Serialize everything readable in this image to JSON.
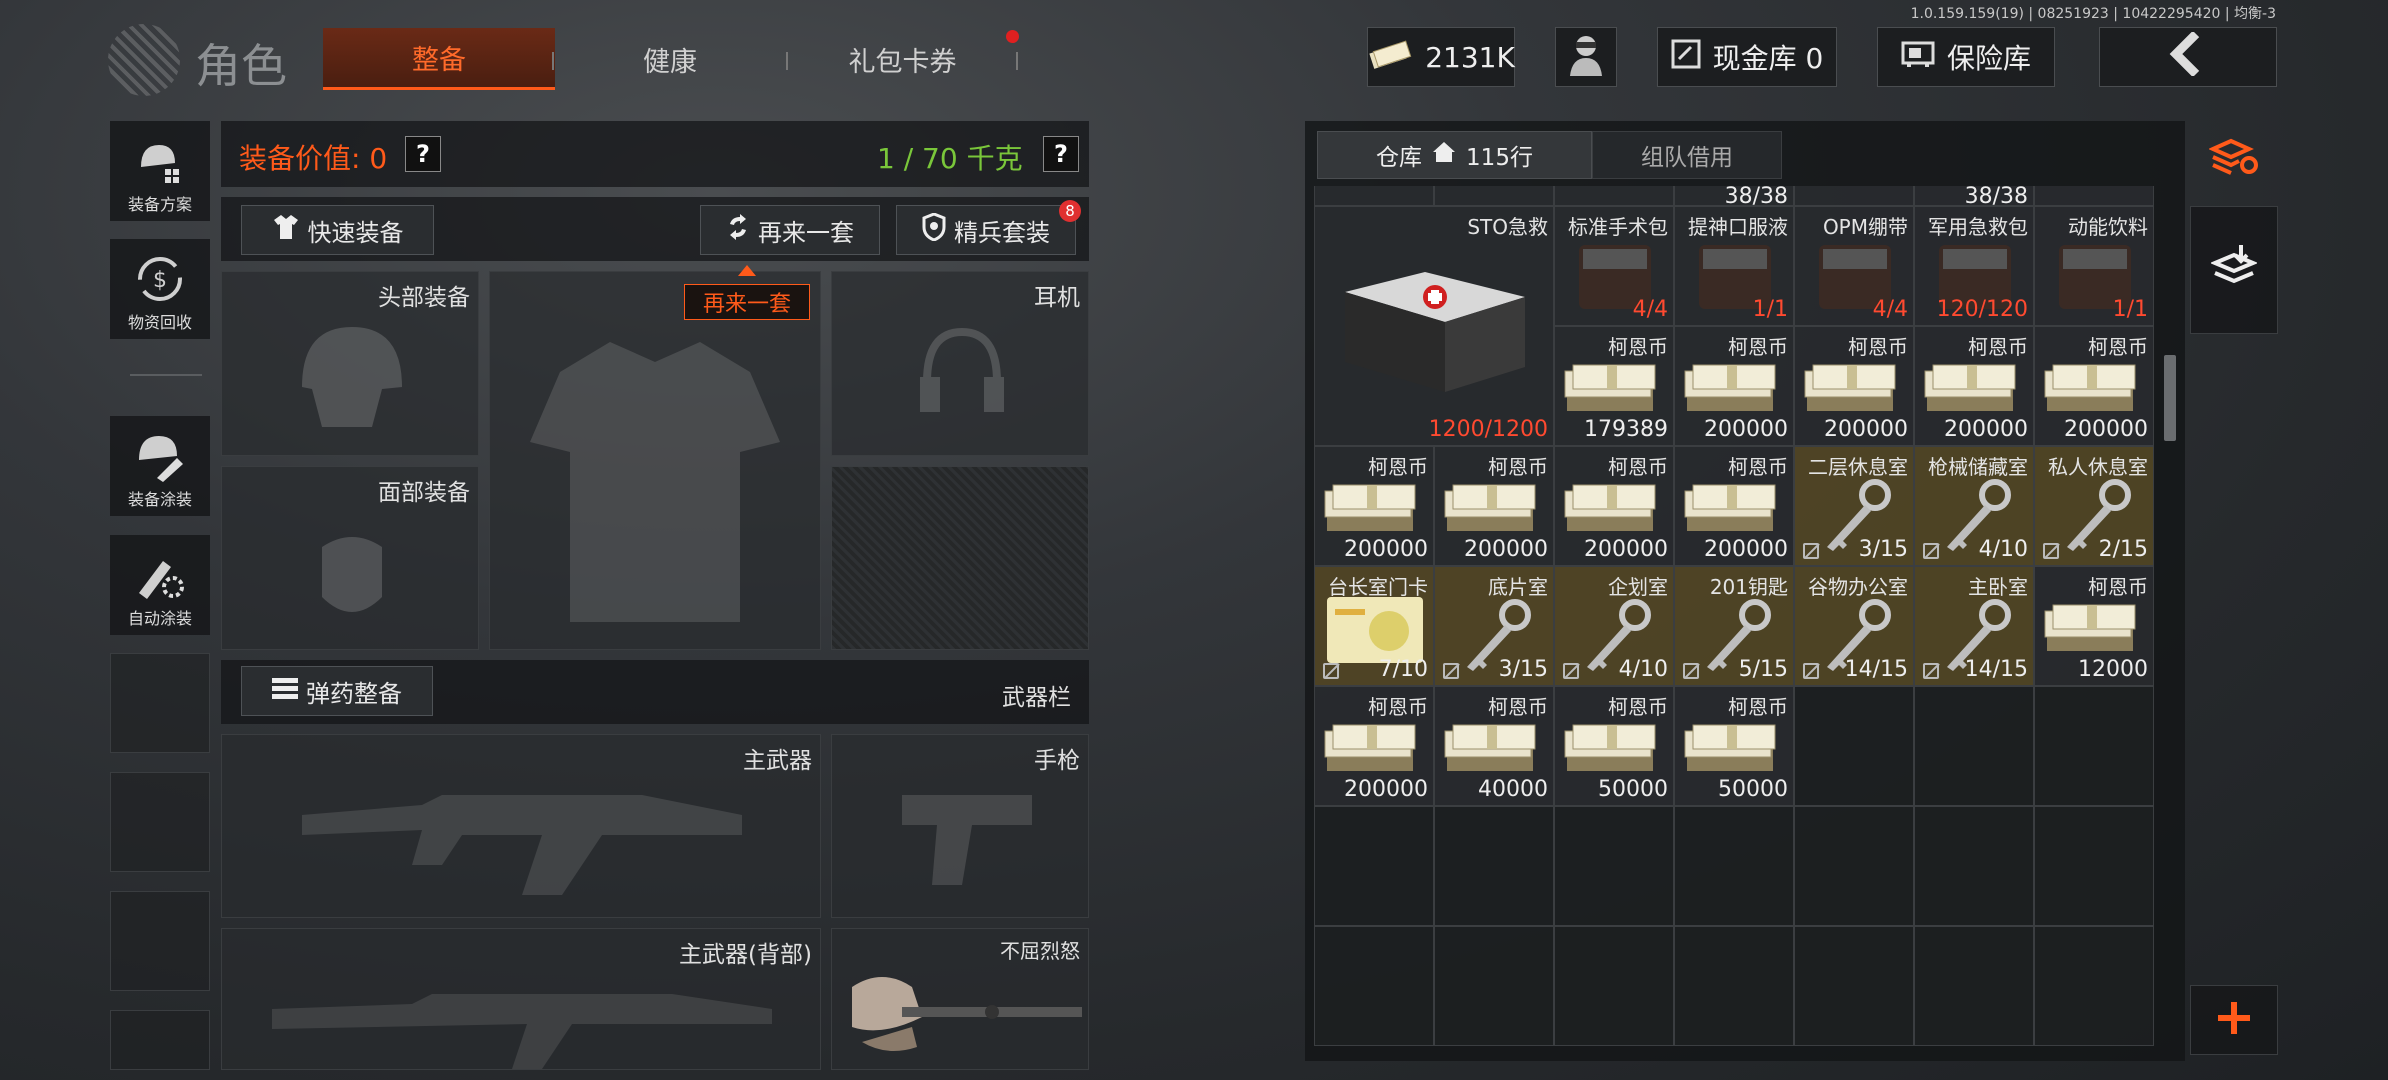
{
  "version": "1.0.159.159(19) | 08251923 | 10422295420 | 均衡-3",
  "header": {
    "title": "角色",
    "tabs": [
      "整备",
      "健康",
      "礼包卡券"
    ],
    "money": "2131K",
    "cash_vault": "现金库 0",
    "safe": "保险库"
  },
  "loadout": {
    "value_label": "装备价值: 0",
    "weight": "1 / 70 千克",
    "quick_equip": "快速装备",
    "again": "再来一套",
    "elite": "精兵套装",
    "elite_badge": "8",
    "tooltip": "再来一套"
  },
  "sidebar": [
    "装备方案",
    "物资回收",
    "装备涂装",
    "自动涂装"
  ],
  "slots": {
    "head": "头部装备",
    "face": "面部装备",
    "earphone": "耳机",
    "ammo": "弹药整备",
    "weapon_bar": "武器栏",
    "primary": "主武器",
    "pistol": "手枪",
    "primary_back": "主武器(背部)",
    "melee": "不屈烈怒"
  },
  "warehouse": {
    "tab_label": "仓库",
    "rows": "115行",
    "team_borrow": "组队借用",
    "partial_top": [
      "38/38",
      "38/38"
    ],
    "sto": {
      "name": "STO急救",
      "count": "1200/1200"
    },
    "items": [
      {
        "name": "标准手术包",
        "count": "4/4",
        "red": true
      },
      {
        "name": "提神口服液",
        "count": "1/1",
        "red": true
      },
      {
        "name": "OPM绷带",
        "count": "4/4",
        "red": true
      },
      {
        "name": "军用急救包",
        "count": "120/120",
        "red": true
      },
      {
        "name": "动能饮料",
        "count": "1/1",
        "red": true
      },
      {
        "name": "柯恩币",
        "count": "179389"
      },
      {
        "name": "柯恩币",
        "count": "200000"
      },
      {
        "name": "柯恩币",
        "count": "200000"
      },
      {
        "name": "柯恩币",
        "count": "200000"
      },
      {
        "name": "柯恩币",
        "count": "200000"
      },
      {
        "name": "柯恩币",
        "count": "200000"
      },
      {
        "name": "柯恩币",
        "count": "200000"
      },
      {
        "name": "柯恩币",
        "count": "200000"
      },
      {
        "name": "柯恩币",
        "count": "200000"
      },
      {
        "name": "二层休息室",
        "count": "3/15",
        "key": true
      },
      {
        "name": "枪械储藏室",
        "count": "4/10",
        "key": true
      },
      {
        "name": "私人休息室",
        "count": "2/15",
        "key": true
      },
      {
        "name": "台长室门卡",
        "count": "7/10",
        "key": true
      },
      {
        "name": "底片室",
        "count": "3/15",
        "key": true
      },
      {
        "name": "企划室",
        "count": "4/10",
        "key": true
      },
      {
        "name": "201钥匙",
        "count": "5/15",
        "key": true
      },
      {
        "name": "谷物办公室",
        "count": "14/15",
        "key": true
      },
      {
        "name": "主卧室",
        "count": "14/15",
        "key": true
      },
      {
        "name": "柯恩币",
        "count": "12000"
      },
      {
        "name": "柯恩币",
        "count": "200000"
      },
      {
        "name": "柯恩币",
        "count": "40000"
      },
      {
        "name": "柯恩币",
        "count": "50000"
      },
      {
        "name": "柯恩币",
        "count": "50000"
      }
    ]
  },
  "colors": {
    "accent": "#ff5a1a",
    "weight_green": "#7ac73a",
    "key_bg": "#6a5a2c"
  }
}
